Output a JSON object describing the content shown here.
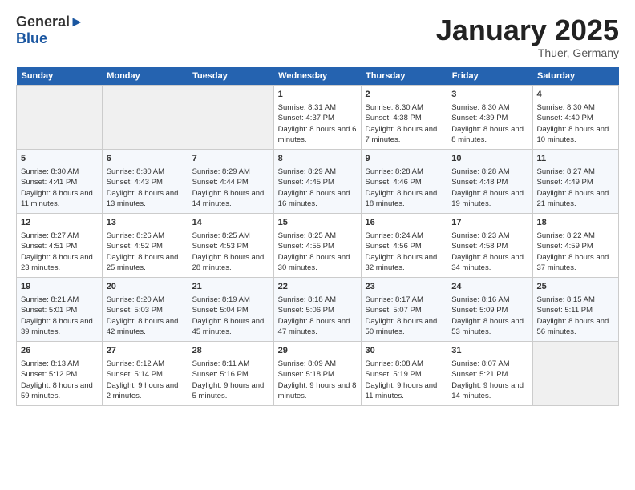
{
  "header": {
    "logo_line1": "General",
    "logo_line2": "Blue",
    "month": "January 2025",
    "location": "Thuer, Germany"
  },
  "days_of_week": [
    "Sunday",
    "Monday",
    "Tuesday",
    "Wednesday",
    "Thursday",
    "Friday",
    "Saturday"
  ],
  "weeks": [
    [
      {
        "day": "",
        "empty": true
      },
      {
        "day": "",
        "empty": true
      },
      {
        "day": "",
        "empty": true
      },
      {
        "day": "1",
        "sunrise": "Sunrise: 8:31 AM",
        "sunset": "Sunset: 4:37 PM",
        "daylight": "Daylight: 8 hours and 6 minutes."
      },
      {
        "day": "2",
        "sunrise": "Sunrise: 8:30 AM",
        "sunset": "Sunset: 4:38 PM",
        "daylight": "Daylight: 8 hours and 7 minutes."
      },
      {
        "day": "3",
        "sunrise": "Sunrise: 8:30 AM",
        "sunset": "Sunset: 4:39 PM",
        "daylight": "Daylight: 8 hours and 8 minutes."
      },
      {
        "day": "4",
        "sunrise": "Sunrise: 8:30 AM",
        "sunset": "Sunset: 4:40 PM",
        "daylight": "Daylight: 8 hours and 10 minutes."
      }
    ],
    [
      {
        "day": "5",
        "sunrise": "Sunrise: 8:30 AM",
        "sunset": "Sunset: 4:41 PM",
        "daylight": "Daylight: 8 hours and 11 minutes."
      },
      {
        "day": "6",
        "sunrise": "Sunrise: 8:30 AM",
        "sunset": "Sunset: 4:43 PM",
        "daylight": "Daylight: 8 hours and 13 minutes."
      },
      {
        "day": "7",
        "sunrise": "Sunrise: 8:29 AM",
        "sunset": "Sunset: 4:44 PM",
        "daylight": "Daylight: 8 hours and 14 minutes."
      },
      {
        "day": "8",
        "sunrise": "Sunrise: 8:29 AM",
        "sunset": "Sunset: 4:45 PM",
        "daylight": "Daylight: 8 hours and 16 minutes."
      },
      {
        "day": "9",
        "sunrise": "Sunrise: 8:28 AM",
        "sunset": "Sunset: 4:46 PM",
        "daylight": "Daylight: 8 hours and 18 minutes."
      },
      {
        "day": "10",
        "sunrise": "Sunrise: 8:28 AM",
        "sunset": "Sunset: 4:48 PM",
        "daylight": "Daylight: 8 hours and 19 minutes."
      },
      {
        "day": "11",
        "sunrise": "Sunrise: 8:27 AM",
        "sunset": "Sunset: 4:49 PM",
        "daylight": "Daylight: 8 hours and 21 minutes."
      }
    ],
    [
      {
        "day": "12",
        "sunrise": "Sunrise: 8:27 AM",
        "sunset": "Sunset: 4:51 PM",
        "daylight": "Daylight: 8 hours and 23 minutes."
      },
      {
        "day": "13",
        "sunrise": "Sunrise: 8:26 AM",
        "sunset": "Sunset: 4:52 PM",
        "daylight": "Daylight: 8 hours and 25 minutes."
      },
      {
        "day": "14",
        "sunrise": "Sunrise: 8:25 AM",
        "sunset": "Sunset: 4:53 PM",
        "daylight": "Daylight: 8 hours and 28 minutes."
      },
      {
        "day": "15",
        "sunrise": "Sunrise: 8:25 AM",
        "sunset": "Sunset: 4:55 PM",
        "daylight": "Daylight: 8 hours and 30 minutes."
      },
      {
        "day": "16",
        "sunrise": "Sunrise: 8:24 AM",
        "sunset": "Sunset: 4:56 PM",
        "daylight": "Daylight: 8 hours and 32 minutes."
      },
      {
        "day": "17",
        "sunrise": "Sunrise: 8:23 AM",
        "sunset": "Sunset: 4:58 PM",
        "daylight": "Daylight: 8 hours and 34 minutes."
      },
      {
        "day": "18",
        "sunrise": "Sunrise: 8:22 AM",
        "sunset": "Sunset: 4:59 PM",
        "daylight": "Daylight: 8 hours and 37 minutes."
      }
    ],
    [
      {
        "day": "19",
        "sunrise": "Sunrise: 8:21 AM",
        "sunset": "Sunset: 5:01 PM",
        "daylight": "Daylight: 8 hours and 39 minutes."
      },
      {
        "day": "20",
        "sunrise": "Sunrise: 8:20 AM",
        "sunset": "Sunset: 5:03 PM",
        "daylight": "Daylight: 8 hours and 42 minutes."
      },
      {
        "day": "21",
        "sunrise": "Sunrise: 8:19 AM",
        "sunset": "Sunset: 5:04 PM",
        "daylight": "Daylight: 8 hours and 45 minutes."
      },
      {
        "day": "22",
        "sunrise": "Sunrise: 8:18 AM",
        "sunset": "Sunset: 5:06 PM",
        "daylight": "Daylight: 8 hours and 47 minutes."
      },
      {
        "day": "23",
        "sunrise": "Sunrise: 8:17 AM",
        "sunset": "Sunset: 5:07 PM",
        "daylight": "Daylight: 8 hours and 50 minutes."
      },
      {
        "day": "24",
        "sunrise": "Sunrise: 8:16 AM",
        "sunset": "Sunset: 5:09 PM",
        "daylight": "Daylight: 8 hours and 53 minutes."
      },
      {
        "day": "25",
        "sunrise": "Sunrise: 8:15 AM",
        "sunset": "Sunset: 5:11 PM",
        "daylight": "Daylight: 8 hours and 56 minutes."
      }
    ],
    [
      {
        "day": "26",
        "sunrise": "Sunrise: 8:13 AM",
        "sunset": "Sunset: 5:12 PM",
        "daylight": "Daylight: 8 hours and 59 minutes."
      },
      {
        "day": "27",
        "sunrise": "Sunrise: 8:12 AM",
        "sunset": "Sunset: 5:14 PM",
        "daylight": "Daylight: 9 hours and 2 minutes."
      },
      {
        "day": "28",
        "sunrise": "Sunrise: 8:11 AM",
        "sunset": "Sunset: 5:16 PM",
        "daylight": "Daylight: 9 hours and 5 minutes."
      },
      {
        "day": "29",
        "sunrise": "Sunrise: 8:09 AM",
        "sunset": "Sunset: 5:18 PM",
        "daylight": "Daylight: 9 hours and 8 minutes."
      },
      {
        "day": "30",
        "sunrise": "Sunrise: 8:08 AM",
        "sunset": "Sunset: 5:19 PM",
        "daylight": "Daylight: 9 hours and 11 minutes."
      },
      {
        "day": "31",
        "sunrise": "Sunrise: 8:07 AM",
        "sunset": "Sunset: 5:21 PM",
        "daylight": "Daylight: 9 hours and 14 minutes."
      },
      {
        "day": "",
        "empty": true
      }
    ]
  ]
}
